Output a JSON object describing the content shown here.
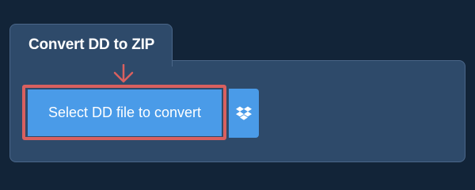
{
  "tab": {
    "title": "Convert DD to ZIP"
  },
  "actions": {
    "select_file_label": "Select DD file to convert",
    "dropbox_icon": "dropbox-icon"
  },
  "colors": {
    "background": "#122438",
    "panel": "#2e4a6a",
    "button": "#4a9be8",
    "highlight": "#d9605f"
  }
}
